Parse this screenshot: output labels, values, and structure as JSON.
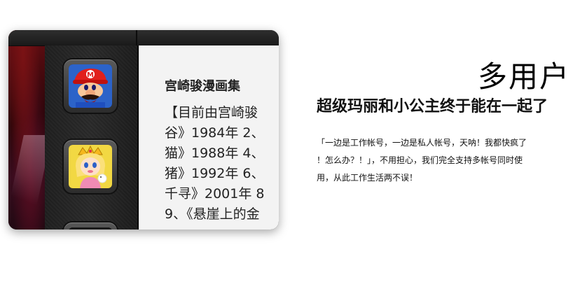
{
  "app": {
    "content_title": "宫崎骏漫画集",
    "content_lines": [
      "【目前由宫崎骏",
      "谷》1984年 2、",
      "猫》1988年 4、",
      "猪》1992年 6、",
      "千寻》2001年 8",
      "9、《悬崖上的金"
    ],
    "accounts": [
      {
        "icon": "mario-avatar-icon"
      },
      {
        "icon": "princess-peach-avatar-icon"
      },
      {
        "icon": "third-account-avatar-icon"
      }
    ]
  },
  "promo": {
    "headline": "多用户",
    "subhead": "超级玛丽和小公主终于能在一起了",
    "desc_lines": [
      "「一边是工作帐号，一边是私人帐号，天呐！我都快疯了",
      "！怎么办？！」，不用担心，我们完全支持多帐号同时使",
      "用，从此工作生活两不误！"
    ]
  }
}
